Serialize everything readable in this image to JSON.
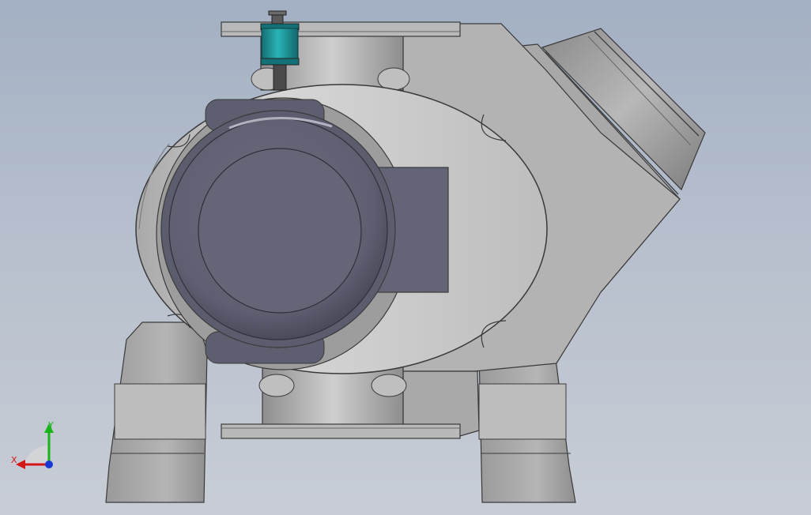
{
  "viewport": {
    "background_top": "#a3b0c3",
    "background_bottom": "#c8cdd5"
  },
  "model": {
    "body_color": "#c8c8c8",
    "plug_color": "#636577",
    "actuator_color": "#1e9ea2"
  },
  "triad": {
    "x_label": "X",
    "y_label": "Y",
    "x_color": "#d41818",
    "y_color": "#18b418",
    "z_color": "#1838d4"
  }
}
